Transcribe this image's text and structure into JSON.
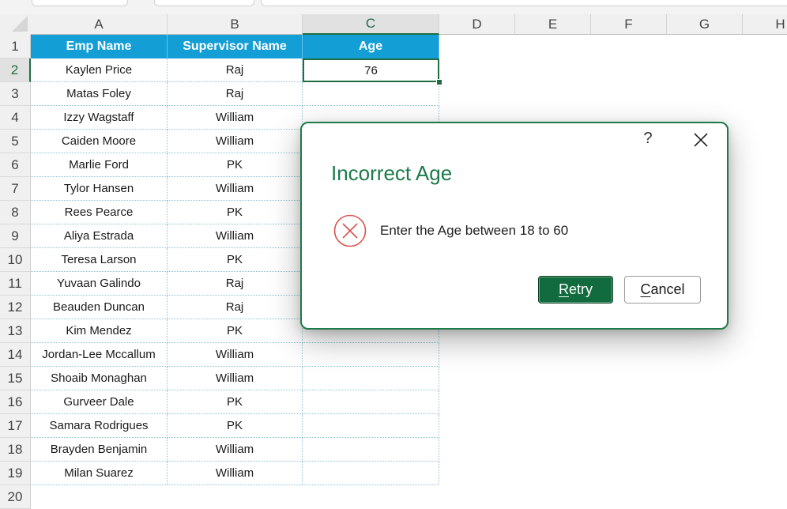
{
  "sheet": {
    "columns": [
      "A",
      "B",
      "C",
      "D",
      "E",
      "F",
      "G",
      "H"
    ],
    "selected_column": "C",
    "selected_row": "2",
    "row_numbers": [
      "1",
      "2",
      "3",
      "4",
      "5",
      "6",
      "7",
      "8",
      "9",
      "10",
      "11",
      "12",
      "13",
      "14",
      "15",
      "16",
      "17",
      "18",
      "19",
      "20"
    ],
    "table_headers": [
      "Emp Name",
      "Supervisor Name",
      "Age"
    ],
    "rows": [
      {
        "emp": "Kaylen Price",
        "supervisor": "Raj",
        "age": "76"
      },
      {
        "emp": "Matas Foley",
        "supervisor": "Raj",
        "age": ""
      },
      {
        "emp": "Izzy Wagstaff",
        "supervisor": "William",
        "age": ""
      },
      {
        "emp": "Caiden Moore",
        "supervisor": "William",
        "age": ""
      },
      {
        "emp": "Marlie Ford",
        "supervisor": "PK",
        "age": ""
      },
      {
        "emp": "Tylor Hansen",
        "supervisor": "William",
        "age": ""
      },
      {
        "emp": "Rees Pearce",
        "supervisor": "PK",
        "age": ""
      },
      {
        "emp": "Aliya Estrada",
        "supervisor": "William",
        "age": ""
      },
      {
        "emp": "Teresa Larson",
        "supervisor": "PK",
        "age": ""
      },
      {
        "emp": "Yuvaan Galindo",
        "supervisor": "Raj",
        "age": ""
      },
      {
        "emp": "Beauden Duncan",
        "supervisor": "Raj",
        "age": ""
      },
      {
        "emp": "Kim Mendez",
        "supervisor": "PK",
        "age": ""
      },
      {
        "emp": "Jordan-Lee Mccallum",
        "supervisor": "William",
        "age": ""
      },
      {
        "emp": "Shoaib Monaghan",
        "supervisor": "William",
        "age": ""
      },
      {
        "emp": "Gurveer Dale",
        "supervisor": "PK",
        "age": ""
      },
      {
        "emp": "Samara Rodrigues",
        "supervisor": "PK",
        "age": ""
      },
      {
        "emp": "Brayden Benjamin",
        "supervisor": "William",
        "age": ""
      },
      {
        "emp": "Milan Suarez",
        "supervisor": "William",
        "age": ""
      }
    ],
    "header_color": "#139fd6",
    "selection_color": "#1f6e43"
  },
  "dialog": {
    "title": "Incorrect Age",
    "help_label": "?",
    "close_icon": "close-icon",
    "error_icon": "error-circle-x-icon",
    "message": "Enter the Age between 18 to 60",
    "retry_label": {
      "accel": "R",
      "rest": "etry"
    },
    "cancel_label": {
      "accel": "C",
      "rest": "ancel"
    },
    "accent_color": "#1d7a4b",
    "retry_color": "#116b3e",
    "error_color": "#d9534f"
  }
}
